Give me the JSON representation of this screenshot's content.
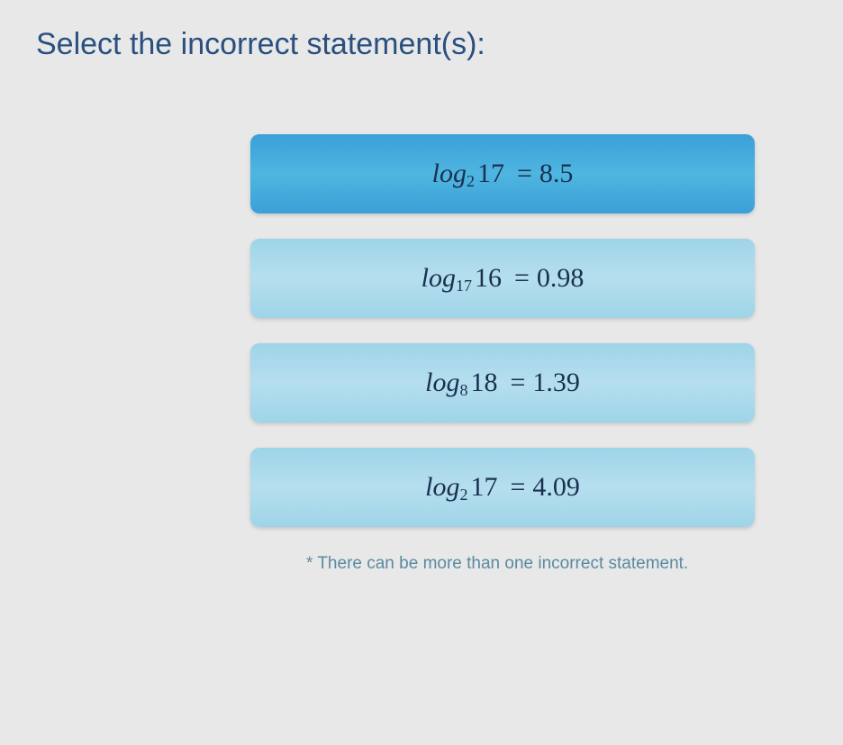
{
  "question": "Select the incorrect statement(s):",
  "options": [
    {
      "log": "log",
      "base": "2",
      "arg": "17",
      "eq": "=",
      "val": "8.5",
      "selected": true
    },
    {
      "log": "log",
      "base": "17",
      "arg": "16",
      "eq": "=",
      "val": "0.98",
      "selected": false
    },
    {
      "log": "log",
      "base": "8",
      "arg": "18",
      "eq": "=",
      "val": "1.39",
      "selected": false
    },
    {
      "log": "log",
      "base": "2",
      "arg": "17",
      "eq": "=",
      "val": "4.09",
      "selected": false
    }
  ],
  "footnote": "* There can be more than one incorrect statement."
}
